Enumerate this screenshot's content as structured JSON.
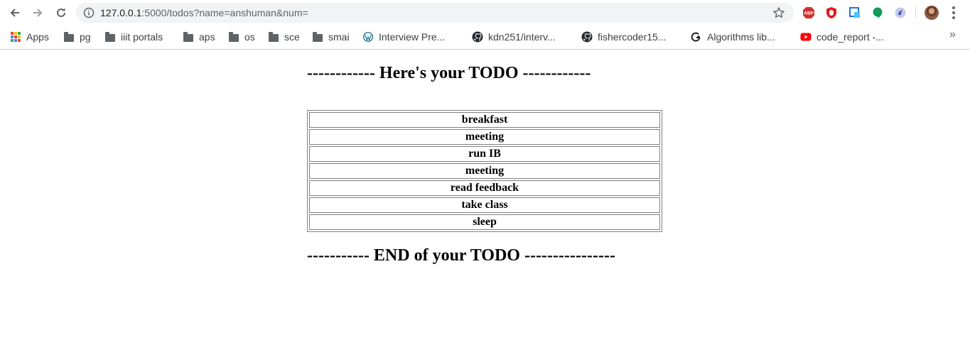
{
  "browser": {
    "url_host": "127.0.0.1",
    "url_rest": ":5000/todos?name=anshuman&num=",
    "icons": {
      "back": "arrow-left-icon",
      "forward": "arrow-right-icon",
      "reload": "reload-icon",
      "info": "info-icon",
      "bookmark_star": "star-icon",
      "menu": "kebab-menu-icon"
    },
    "extensions": [
      {
        "name": "adblock-plus",
        "label": "ABP",
        "color": "#d32f2f"
      },
      {
        "name": "ublock",
        "color": "#e3181c"
      },
      {
        "name": "screen-capture",
        "color": "#1a73e8"
      },
      {
        "name": "hangouts",
        "color": "#0f9d58"
      },
      {
        "name": "refresh-ext",
        "color": "#7d8fc7"
      }
    ]
  },
  "bookmarks": [
    {
      "label": "Apps",
      "icon": "apps-grid-icon"
    },
    {
      "label": "pg",
      "icon": "folder-icon"
    },
    {
      "label": "iiit portals",
      "icon": "folder-icon"
    },
    {
      "label": "aps",
      "icon": "folder-icon"
    },
    {
      "label": "os",
      "icon": "folder-icon"
    },
    {
      "label": "sce",
      "icon": "folder-icon"
    },
    {
      "label": "smai",
      "icon": "folder-icon"
    },
    {
      "label": "Interview Pre...",
      "icon": "wordpress-icon"
    },
    {
      "label": "kdn251/interv...",
      "icon": "github-icon"
    },
    {
      "label": "fishercoder15...",
      "icon": "github-icon"
    },
    {
      "label": "Algorithms lib...",
      "icon": "google-plus-icon"
    },
    {
      "label": "code_report -...",
      "icon": "youtube-icon"
    }
  ],
  "bookmarks_overflow": "»",
  "page": {
    "title_top": "------------ Here's your TODO ------------",
    "title_bottom": "----------- END of your TODO ----------------",
    "todos": [
      "breakfast",
      "meeting",
      "run IB",
      "meeting",
      "read feedback",
      "take class",
      "sleep"
    ]
  }
}
